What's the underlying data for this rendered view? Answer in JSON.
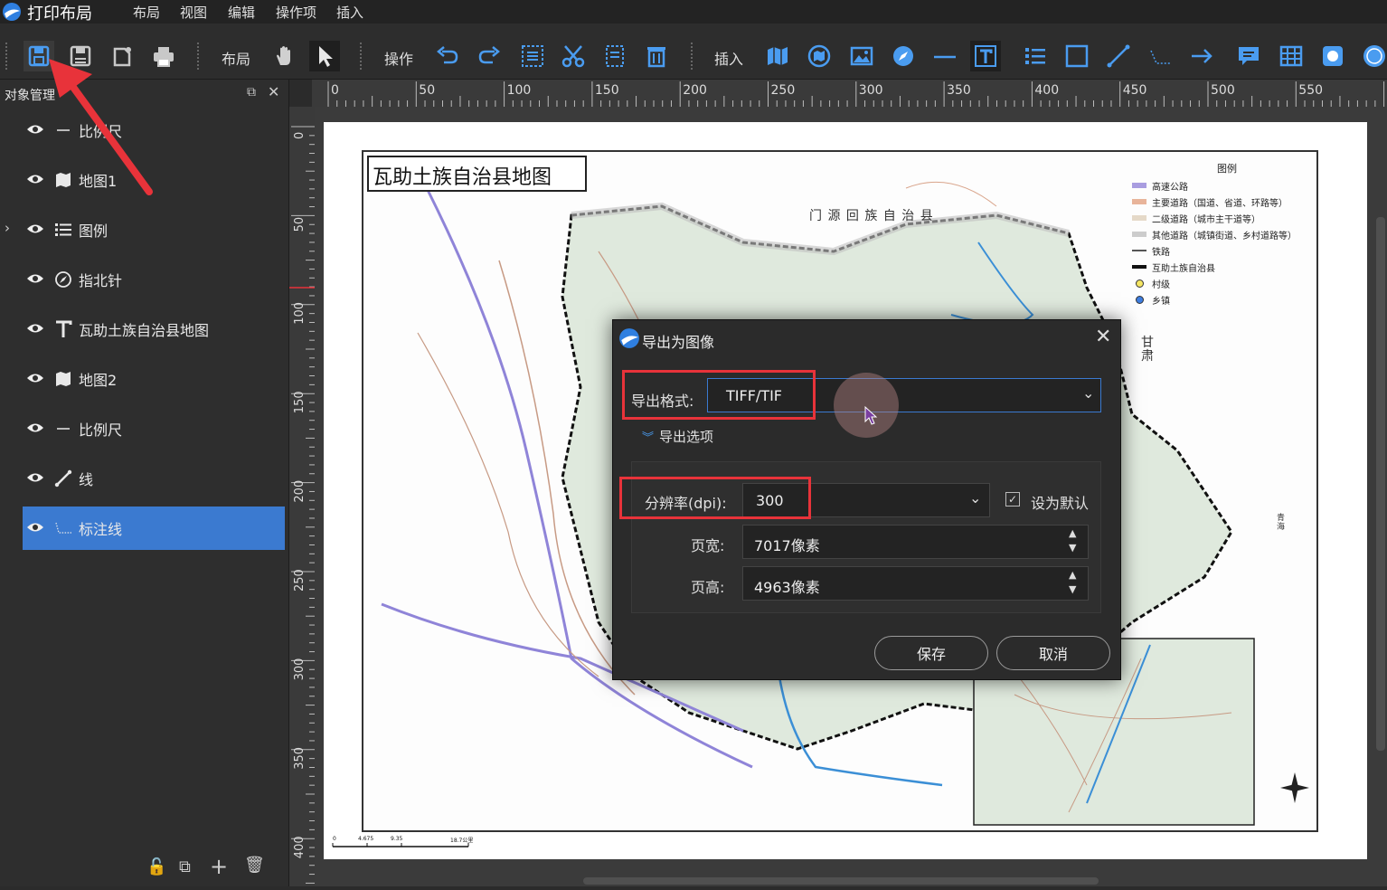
{
  "app": {
    "title": "打印布局"
  },
  "menu": [
    "布局",
    "视图",
    "编辑",
    "操作项",
    "插入"
  ],
  "toolbar": {
    "group_layout": "布局",
    "group_operate": "操作",
    "group_insert": "插入"
  },
  "panel": {
    "title": "对象管理",
    "items": [
      {
        "label": "比例尺",
        "icon": "scalebar-icon"
      },
      {
        "label": "地图1",
        "icon": "map-icon"
      },
      {
        "label": "图例",
        "icon": "legend-icon"
      },
      {
        "label": "指北针",
        "icon": "compass-icon"
      },
      {
        "label": "瓦助土族自治县地图",
        "icon": "text-icon"
      },
      {
        "label": "地图2",
        "icon": "map-icon"
      },
      {
        "label": "比例尺",
        "icon": "scalebar-icon"
      },
      {
        "label": "线",
        "icon": "line-icon"
      },
      {
        "label": "标注线",
        "icon": "annotation-line-icon"
      }
    ],
    "selected_index": 8
  },
  "ruler": {
    "top_ticks": [
      "0",
      "50",
      "100",
      "150",
      "200",
      "250",
      "300",
      "350",
      "400",
      "450",
      "500",
      "550",
      "6"
    ],
    "left_ticks": [
      "0",
      "50",
      "100",
      "150",
      "200",
      "250",
      "300",
      "350",
      "400"
    ]
  },
  "map": {
    "title": "瓦助土族自治县地图",
    "region_label": "门 源 回 族 自 治 县",
    "side_label": "甘肃",
    "side_label2": "青海",
    "scale_labels": [
      "0",
      "4.675",
      "9.35",
      "18.7公里"
    ],
    "legend": {
      "title": "图例",
      "items": [
        {
          "label": "高速公路",
          "color": "#a99de0"
        },
        {
          "label": "主要道路（国道、省道、环路等）",
          "color": "#e8b49a"
        },
        {
          "label": "二级道路（城市主干道等）",
          "color": "#e5d9c8"
        },
        {
          "label": "其他道路（城镇街道、乡村道路等）",
          "color": "#cccccc"
        },
        {
          "label": "铁路",
          "color": "#555555"
        },
        {
          "label": "互助土族自治县",
          "color": "#111111"
        },
        {
          "label": "村级",
          "color": "#f5e663"
        },
        {
          "label": "乡镇",
          "color": "#3d7de0"
        }
      ]
    }
  },
  "dialog": {
    "title": "导出为图像",
    "format_label": "导出格式:",
    "format_value": "TIFF/TIF",
    "options_toggle": "导出选项",
    "dpi_label": "分辨率(dpi):",
    "dpi_value": "300",
    "set_default_label": "设为默认",
    "set_default_checked": true,
    "width_label": "页宽:",
    "width_value": "7017像素",
    "height_label": "页高:",
    "height_value": "4963像素",
    "save_label": "保存",
    "cancel_label": "取消"
  }
}
